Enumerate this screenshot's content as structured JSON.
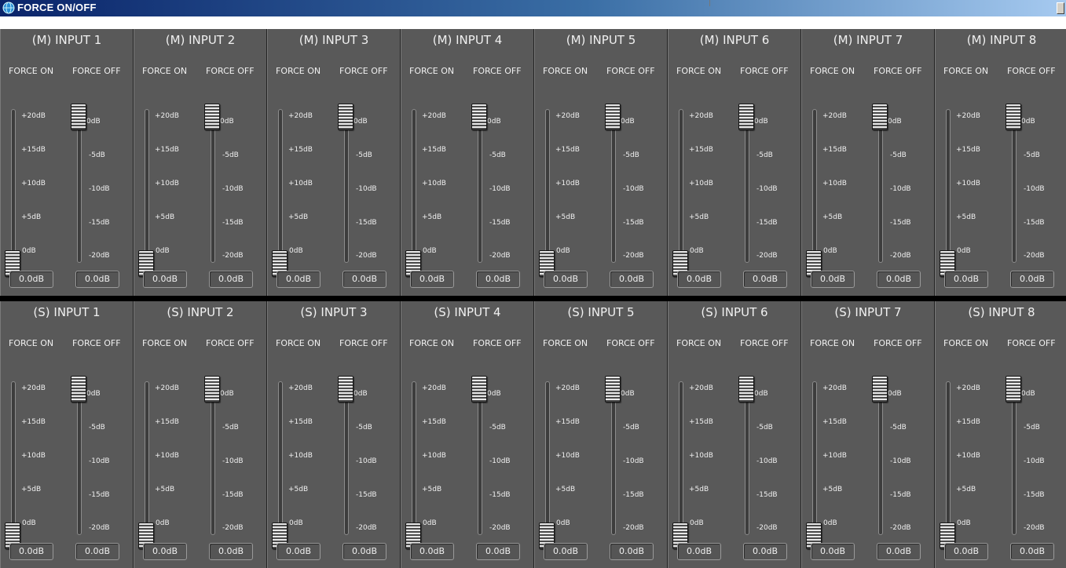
{
  "window": {
    "title": "FORCE ON/OFF"
  },
  "labels": {
    "force_on": "FORCE ON",
    "force_off": "FORCE OFF"
  },
  "scales": {
    "on": [
      "+20dB",
      "+15dB",
      "+10dB",
      "+5dB",
      "0dB"
    ],
    "off": [
      "0dB",
      "-5dB",
      "-10dB",
      "-15dB",
      "-20dB"
    ]
  },
  "rows": [
    {
      "prefix": "M",
      "channels": [
        {
          "title": "(M) INPUT 1",
          "on_value": "0.0dB",
          "off_value": "0.0dB",
          "on_level_db": 0,
          "off_level_db": 0
        },
        {
          "title": "(M) INPUT 2",
          "on_value": "0.0dB",
          "off_value": "0.0dB",
          "on_level_db": 0,
          "off_level_db": 0
        },
        {
          "title": "(M) INPUT 3",
          "on_value": "0.0dB",
          "off_value": "0.0dB",
          "on_level_db": 0,
          "off_level_db": 0
        },
        {
          "title": "(M) INPUT 4",
          "on_value": "0.0dB",
          "off_value": "0.0dB",
          "on_level_db": 0,
          "off_level_db": 0
        },
        {
          "title": "(M) INPUT 5",
          "on_value": "0.0dB",
          "off_value": "0.0dB",
          "on_level_db": 0,
          "off_level_db": 0
        },
        {
          "title": "(M) INPUT 6",
          "on_value": "0.0dB",
          "off_value": "0.0dB",
          "on_level_db": 0,
          "off_level_db": 0
        },
        {
          "title": "(M) INPUT 7",
          "on_value": "0.0dB",
          "off_value": "0.0dB",
          "on_level_db": 0,
          "off_level_db": 0
        },
        {
          "title": "(M) INPUT 8",
          "on_value": "0.0dB",
          "off_value": "0.0dB",
          "on_level_db": 0,
          "off_level_db": 0
        }
      ]
    },
    {
      "prefix": "S",
      "channels": [
        {
          "title": "(S) INPUT 1",
          "on_value": "0.0dB",
          "off_value": "0.0dB",
          "on_level_db": 0,
          "off_level_db": 0
        },
        {
          "title": "(S) INPUT 2",
          "on_value": "0.0dB",
          "off_value": "0.0dB",
          "on_level_db": 0,
          "off_level_db": 0
        },
        {
          "title": "(S) INPUT 3",
          "on_value": "0.0dB",
          "off_value": "0.0dB",
          "on_level_db": 0,
          "off_level_db": 0
        },
        {
          "title": "(S) INPUT 4",
          "on_value": "0.0dB",
          "off_value": "0.0dB",
          "on_level_db": 0,
          "off_level_db": 0
        },
        {
          "title": "(S) INPUT 5",
          "on_value": "0.0dB",
          "off_value": "0.0dB",
          "on_level_db": 0,
          "off_level_db": 0
        },
        {
          "title": "(S) INPUT 6",
          "on_value": "0.0dB",
          "off_value": "0.0dB",
          "on_level_db": 0,
          "off_level_db": 0
        },
        {
          "title": "(S) INPUT 7",
          "on_value": "0.0dB",
          "off_value": "0.0dB",
          "on_level_db": 0,
          "off_level_db": 0
        },
        {
          "title": "(S) INPUT 8",
          "on_value": "0.0dB",
          "off_value": "0.0dB",
          "on_level_db": 0,
          "off_level_db": 0
        }
      ]
    }
  ],
  "colors": {
    "panel": "#595959",
    "text": "#f0f0f0",
    "title_bar": "#0a246a"
  },
  "icons": {
    "app": "app-globe-icon"
  }
}
